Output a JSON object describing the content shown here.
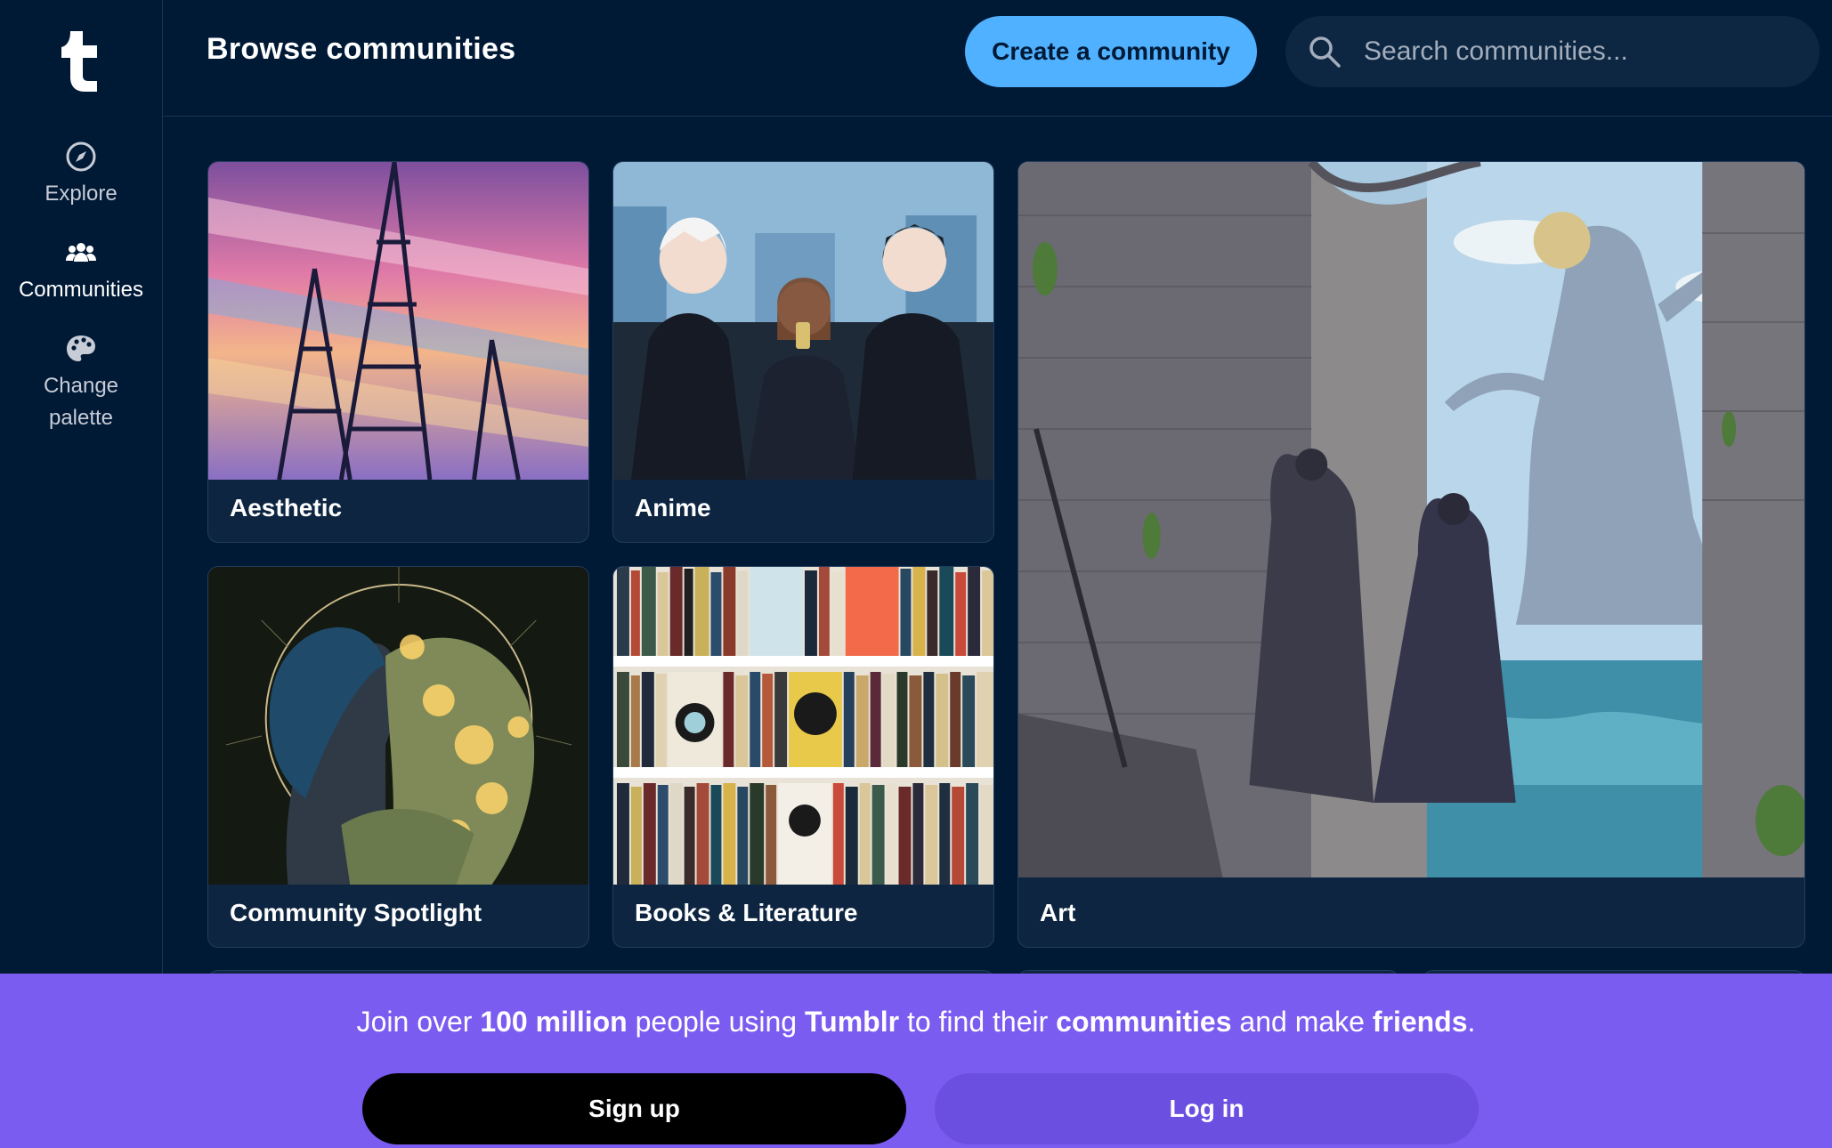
{
  "sidebar": {
    "logo": "t",
    "items": [
      {
        "label": "Explore",
        "icon": "compass-icon"
      },
      {
        "label": "Communities",
        "icon": "people-icon"
      },
      {
        "label": "Change palette",
        "icon": "palette-icon"
      }
    ]
  },
  "header": {
    "title": "Browse communities",
    "create_label": "Create a community",
    "search_placeholder": "Search communities..."
  },
  "cards": {
    "aesthetic": "Aesthetic",
    "anime": "Anime",
    "spotlight": "Community Spotlight",
    "books": "Books & Literature",
    "art": "Art"
  },
  "banner": {
    "p1": "Join over ",
    "b1": "100 million",
    "p2": " people using ",
    "b2": "Tumblr",
    "p3": " to find their ",
    "b3": "communities",
    "p4": " and make ",
    "b4": "friends",
    "p5": ".",
    "signup_label": "Sign up",
    "login_label": "Log in"
  },
  "colors": {
    "background": "#001935",
    "accent_blue": "#4fb1ff",
    "banner_purple": "#7b5cf0"
  }
}
